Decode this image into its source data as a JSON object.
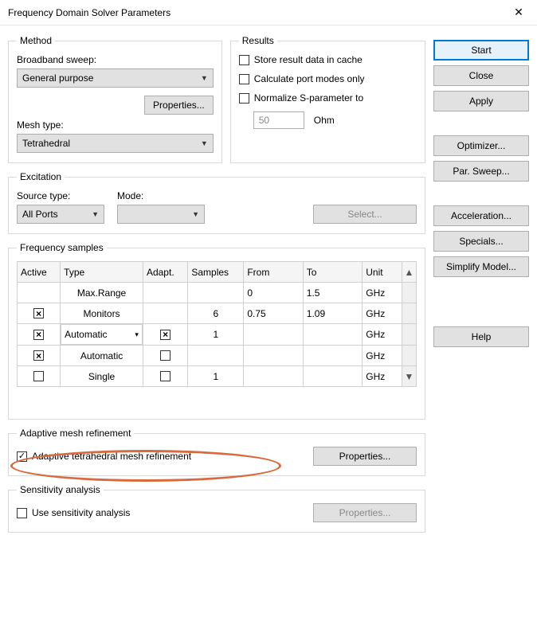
{
  "window": {
    "title": "Frequency Domain Solver Parameters"
  },
  "method": {
    "legend": "Method",
    "broadband_label": "Broadband sweep:",
    "broadband_value": "General purpose",
    "properties_btn": "Properties...",
    "meshtype_label": "Mesh type:",
    "meshtype_value": "Tetrahedral"
  },
  "results": {
    "legend": "Results",
    "store_cache": "Store result data in cache",
    "calc_port": "Calculate port modes only",
    "normalize": "Normalize S-parameter to",
    "ohm_value": "50",
    "ohm_unit": "Ohm"
  },
  "excitation": {
    "legend": "Excitation",
    "source_label": "Source type:",
    "source_value": "All Ports",
    "mode_label": "Mode:",
    "select_btn": "Select..."
  },
  "freq": {
    "legend": "Frequency samples",
    "headers": [
      "Active",
      "Type",
      "Adapt.",
      "Samples",
      "From",
      "To",
      "Unit"
    ],
    "rows": [
      {
        "active": null,
        "type": "Max.Range",
        "adapt": null,
        "samples": "",
        "from": "0",
        "to": "1.5",
        "unit": "GHz"
      },
      {
        "active": true,
        "type": "Monitors",
        "adapt": null,
        "samples": "6",
        "from": "0.75",
        "to": "1.09",
        "unit": "GHz"
      },
      {
        "active": true,
        "type": "Automatic",
        "type_dd": true,
        "adapt": true,
        "samples": "1",
        "from": "",
        "to": "",
        "unit": "GHz"
      },
      {
        "active": true,
        "type": "Automatic",
        "adapt": false,
        "samples": "",
        "from": "",
        "to": "",
        "unit": "GHz"
      },
      {
        "active": false,
        "type": "Single",
        "adapt": false,
        "samples": "1",
        "from": "",
        "to": "",
        "unit": "GHz"
      }
    ]
  },
  "amr": {
    "legend": "Adaptive mesh refinement",
    "chk_label": "Adaptive tetrahedral mesh refinement",
    "props": "Properties..."
  },
  "sens": {
    "legend": "Sensitivity analysis",
    "chk_label": "Use sensitivity analysis",
    "props": "Properties..."
  },
  "buttons": {
    "start": "Start",
    "close": "Close",
    "apply": "Apply",
    "optimizer": "Optimizer...",
    "parsweep": "Par. Sweep...",
    "accel": "Acceleration...",
    "specials": "Specials...",
    "simplify": "Simplify Model...",
    "help": "Help"
  }
}
